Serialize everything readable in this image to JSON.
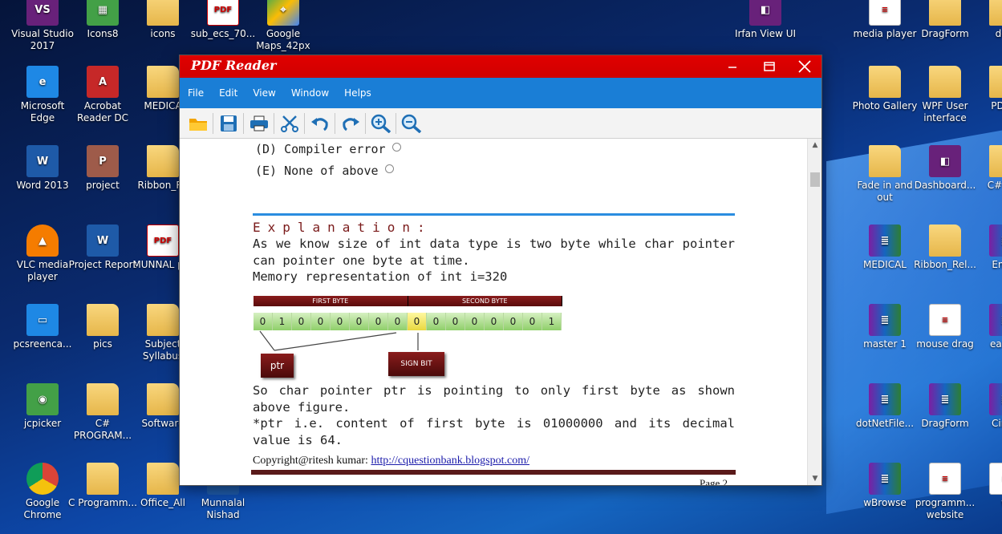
{
  "desktop": {
    "left_icons": [
      {
        "label": "Visual Studio 2017",
        "kind": "vs",
        "glyph": "VS"
      },
      {
        "label": "Icons8",
        "kind": "green",
        "glyph": "▦"
      },
      {
        "label": "icons",
        "kind": "folder",
        "glyph": ""
      },
      {
        "label": "sub_ecs_70...",
        "kind": "pdf",
        "glyph": "PDF"
      },
      {
        "label": "Google Maps_42px",
        "kind": "map",
        "glyph": "⌖"
      },
      {
        "label": "Microsoft Edge",
        "kind": "blue",
        "glyph": "e"
      },
      {
        "label": "Acrobat Reader DC",
        "kind": "red",
        "glyph": "A"
      },
      {
        "label": "MEDICA",
        "kind": "folder",
        "glyph": ""
      },
      {
        "label": "Word 2013",
        "kind": "word",
        "glyph": "W"
      },
      {
        "label": "project",
        "kind": "ppt",
        "glyph": "P"
      },
      {
        "label": "Ribbon_Re",
        "kind": "folder",
        "glyph": ""
      },
      {
        "label": "VLC media player",
        "kind": "vlc",
        "glyph": "▲"
      },
      {
        "label": "Project Report",
        "kind": "word",
        "glyph": "W"
      },
      {
        "label": "MUNNAL pdf",
        "kind": "pdf",
        "glyph": "PDF"
      },
      {
        "label": "pcsreencа...",
        "kind": "blue",
        "glyph": "▭"
      },
      {
        "label": "pics",
        "kind": "folder",
        "glyph": ""
      },
      {
        "label": "Subject Syllabus",
        "kind": "folder",
        "glyph": ""
      },
      {
        "label": "jcpicker",
        "kind": "green",
        "glyph": "◉"
      },
      {
        "label": "C# PROGRAM...",
        "kind": "folder",
        "glyph": ""
      },
      {
        "label": "Software",
        "kind": "folder",
        "glyph": ""
      },
      {
        "label": "Google Chrome",
        "kind": "chrome",
        "glyph": ""
      },
      {
        "label": "C Programm...",
        "kind": "folder",
        "glyph": ""
      },
      {
        "label": "Office_All",
        "kind": "folder",
        "glyph": ""
      },
      {
        "label": "Munnalal Nishad",
        "kind": "word",
        "glyph": "W"
      }
    ],
    "edge_labels_left": [
      "er",
      "..",
      "d",
      ".6",
      "",
      "m",
      "",
      ""
    ],
    "right_icons": [
      {
        "label": "Irfan View UI",
        "kind": "vs",
        "glyph": "◧"
      },
      {
        "label": "media player",
        "kind": "doc",
        "glyph": "≡"
      },
      {
        "label": "DragForm",
        "kind": "folder",
        "glyph": ""
      },
      {
        "label": "dow",
        "kind": "folder",
        "glyph": ""
      },
      {
        "label": "Photo Gallery",
        "kind": "folder",
        "glyph": ""
      },
      {
        "label": "WPF User interface",
        "kind": "folder",
        "glyph": ""
      },
      {
        "label": "PDF R",
        "kind": "folder",
        "glyph": ""
      },
      {
        "label": "Fade in and out",
        "kind": "folder",
        "glyph": ""
      },
      {
        "label": "Dashboard...",
        "kind": "vs",
        "glyph": "◧"
      },
      {
        "label": "C# Proj",
        "kind": "folder",
        "glyph": ""
      },
      {
        "label": "MEDICAL",
        "kind": "rar",
        "glyph": "≣"
      },
      {
        "label": "Ribbon_Rel...",
        "kind": "folder",
        "glyph": ""
      },
      {
        "label": "Email",
        "kind": "rar",
        "glyph": "≣"
      },
      {
        "label": "master 1",
        "kind": "rar",
        "glyph": "≣"
      },
      {
        "label": "mouse drag",
        "kind": "doc",
        "glyph": "≡"
      },
      {
        "label": "easyw",
        "kind": "rar",
        "glyph": "≣"
      },
      {
        "label": "dotNetFile...",
        "kind": "rar",
        "glyph": "≣"
      },
      {
        "label": "DragForm",
        "kind": "rar",
        "glyph": "≣"
      },
      {
        "label": "Circul",
        "kind": "rar",
        "glyph": "≣"
      },
      {
        "label": "wBrowse",
        "kind": "rar",
        "glyph": "≣"
      },
      {
        "label": "programm... website",
        "kind": "doc",
        "glyph": "≡"
      },
      {
        "label": "w",
        "kind": "doc",
        "glyph": "≡"
      }
    ]
  },
  "app": {
    "title": "PDF Reader",
    "menu": [
      "File",
      "Edit",
      "View",
      "Window",
      "Helps"
    ],
    "toolbar": [
      {
        "name": "open-folder-icon",
        "color": "#f2a400"
      },
      {
        "name": "save-icon",
        "color": "#1f6fb5"
      },
      {
        "name": "print-icon",
        "color": "#1f6fb5"
      },
      {
        "name": "cut-icon",
        "color": "#1f6fb5"
      },
      {
        "name": "undo-icon",
        "color": "#1f6fb5"
      },
      {
        "name": "redo-icon",
        "color": "#1f6fb5"
      },
      {
        "name": "zoom-in-icon",
        "color": "#1f6fb5"
      },
      {
        "name": "zoom-out-icon",
        "color": "#1f6fb5"
      }
    ]
  },
  "document": {
    "option_d": "(D) Compiler error",
    "option_e": "(E) None of above",
    "explanation_heading": "Explanation:",
    "paragraph1": "As we know size of int data type is two byte while char pointer can pointer one byte at time.",
    "paragraph1_line3": "Memory representation of int i=320",
    "diagram": {
      "first_byte_label": "FIRST BYTE",
      "second_byte_label": "SECOND BYTE",
      "bits": [
        "0",
        "1",
        "0",
        "0",
        "0",
        "0",
        "0",
        "0",
        "0",
        "0",
        "0",
        "0",
        "0",
        "0",
        "0",
        "1"
      ],
      "ptr_label": "ptr",
      "sign_bit_label": "SIGN BIT"
    },
    "paragraph2": "So char pointer ptr is pointing to only first byte as shown above figure.",
    "paragraph3": "*ptr i.e. content of first byte is 01000000 and its decimal value is 64.",
    "copyright_prefix": "Copyright@ritesh kumar: ",
    "copyright_link": "http://cquestionbank.blogspot.com/",
    "page_label": "Page 2"
  }
}
